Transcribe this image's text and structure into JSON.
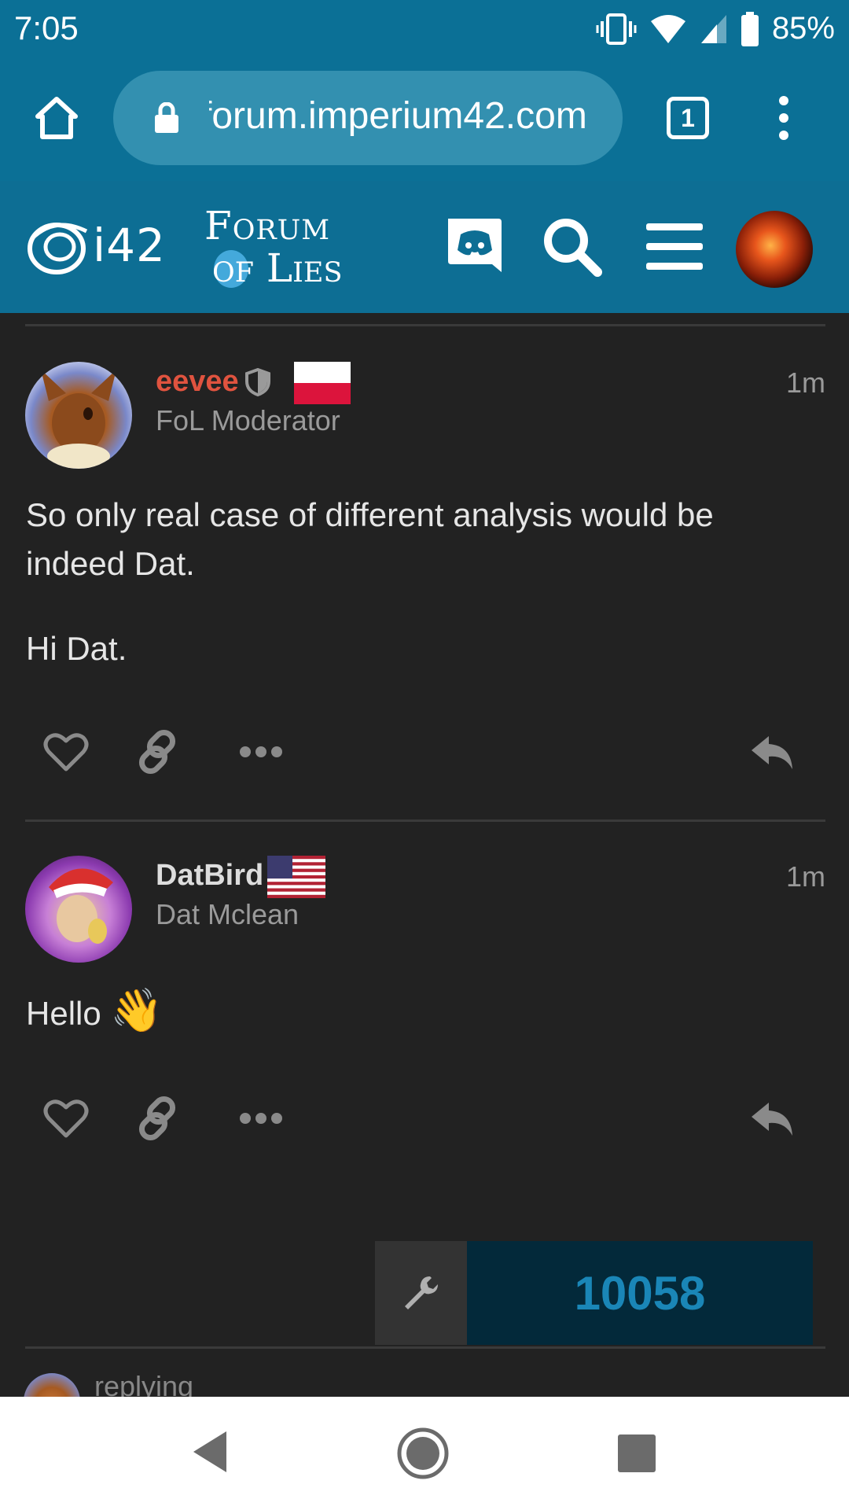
{
  "status_bar": {
    "time": "7:05",
    "battery_percent": "85%"
  },
  "browser": {
    "url": "forum.imperium42.com",
    "tab_count": "1"
  },
  "forum_header": {
    "logo_text": "i42",
    "forum_logo_line1": "Forum",
    "forum_logo_line2": "of Lies"
  },
  "posts": [
    {
      "username": "eevee",
      "username_color": "#e0533f",
      "user_title": "FoL Moderator",
      "flag": "poland",
      "time": "1m",
      "body": [
        "So only real case of different analysis would be indeed Dat.",
        "Hi Dat."
      ]
    },
    {
      "username": "DatBird",
      "username_color": "#dddddd",
      "user_title": "Dat Mclean",
      "flag": "usa",
      "time": "1m",
      "body_text": "Hello",
      "body_emoji": "👋"
    }
  ],
  "footer": {
    "counter": "10058",
    "replying_text": "replying"
  }
}
